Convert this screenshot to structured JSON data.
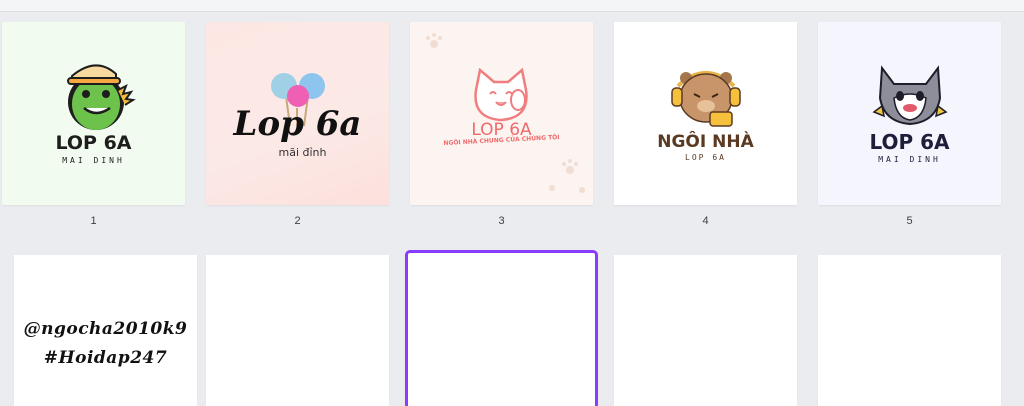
{
  "pages": [
    {
      "number": "1",
      "title": "LOP 6A",
      "subtitle": "MAI DINH",
      "bg": "#f2fbef",
      "icon": "dinosaur-mascot-icon"
    },
    {
      "number": "2",
      "title": "Lop 6a",
      "subtitle": "mãi đỉnh",
      "bg": "#fbe4e2",
      "icon": "cotton-candy-icon"
    },
    {
      "number": "3",
      "title": "LOP 6A",
      "subtitle": "NGÔI NHÀ CHUNG CỦA CHÚNG TÔI",
      "bg": "#fcf4f1",
      "icon": "cat-mascot-icon"
    },
    {
      "number": "4",
      "title": "NGÔI NHÀ",
      "subtitle": "LOP 6A",
      "bg": "#ffffff",
      "icon": "bear-headphones-icon"
    },
    {
      "number": "5",
      "title": "LOP 6A",
      "subtitle": "MAI DINH",
      "bg": "#f5f5fd",
      "icon": "wolf-mascot-icon"
    }
  ],
  "row2": {
    "page6_line1": "@ngocha2010k9",
    "page6_line2": "#Hoidap247"
  },
  "colors": {
    "selection": "#8b3dff",
    "canvas_bg": "#ebecf0"
  }
}
